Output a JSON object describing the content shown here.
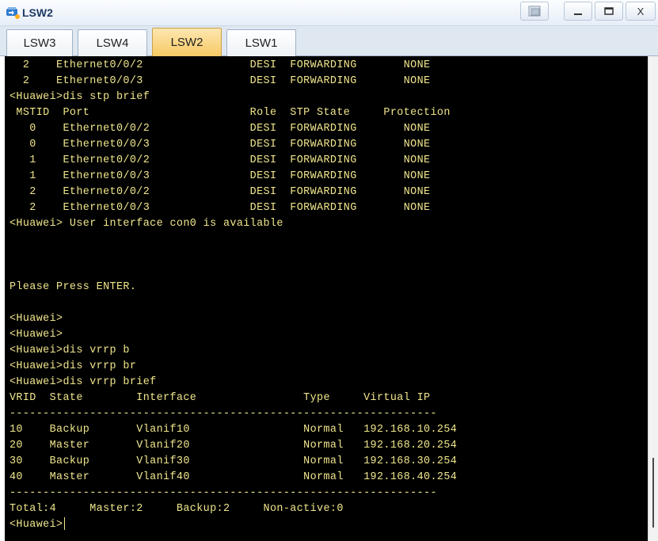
{
  "window": {
    "title": "LSW2",
    "buttons": [
      "restore-view",
      "minimize",
      "maximize",
      "close"
    ],
    "close_label": "X"
  },
  "tabs": [
    {
      "label": "LSW3",
      "active": false
    },
    {
      "label": "LSW4",
      "active": false
    },
    {
      "label": "LSW2",
      "active": true
    },
    {
      "label": "LSW1",
      "active": false
    }
  ],
  "terminal": {
    "text_color": "#f0e68c",
    "background": "#000000",
    "lines": [
      "  2    Ethernet0/0/2                DESI  FORWARDING       NONE",
      "  2    Ethernet0/0/3                DESI  FORWARDING       NONE",
      "<Huawei>dis stp brief",
      " MSTID  Port                        Role  STP State     Protection",
      "   0    Ethernet0/0/2               DESI  FORWARDING       NONE",
      "   0    Ethernet0/0/3               DESI  FORWARDING       NONE",
      "   1    Ethernet0/0/2               DESI  FORWARDING       NONE",
      "   1    Ethernet0/0/3               DESI  FORWARDING       NONE",
      "   2    Ethernet0/0/2               DESI  FORWARDING       NONE",
      "   2    Ethernet0/0/3               DESI  FORWARDING       NONE",
      "<Huawei> User interface con0 is available",
      "",
      "",
      "",
      "Please Press ENTER.",
      "",
      "<Huawei>",
      "<Huawei>",
      "<Huawei>dis vrrp b",
      "<Huawei>dis vrrp br",
      "<Huawei>dis vrrp brief",
      "VRID  State        Interface                Type     Virtual IP",
      "----------------------------------------------------------------",
      "10    Backup       Vlanif10                 Normal   192.168.10.254",
      "20    Master       Vlanif20                 Normal   192.168.20.254",
      "30    Backup       Vlanif30                 Normal   192.168.30.254",
      "40    Master       Vlanif40                 Normal   192.168.40.254",
      "----------------------------------------------------------------",
      "Total:4     Master:2     Backup:2     Non-active:0",
      "<Huawei>"
    ]
  }
}
